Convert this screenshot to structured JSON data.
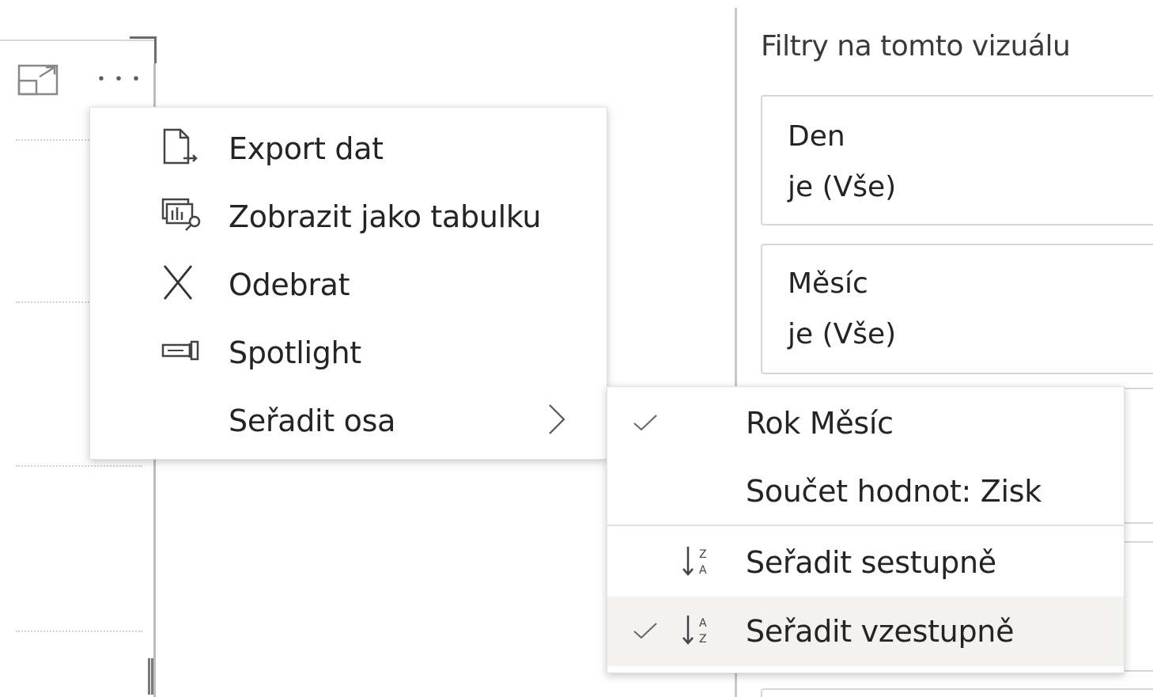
{
  "filter_pane": {
    "title": "Filtry na tomto vizuálu",
    "cards": [
      {
        "name": "Den",
        "value": "je (Vše)"
      },
      {
        "name": "Měsíc",
        "value": "je (Vše)"
      }
    ]
  },
  "visual_header": {
    "focus_icon": "focus-mode-icon",
    "more_icon": "more-options-icon"
  },
  "context_menu": {
    "items": [
      {
        "label": "Export dat",
        "icon": "export-data-icon"
      },
      {
        "label": "Zobrazit jako tabulku",
        "icon": "show-as-table-icon"
      },
      {
        "label": "Odebrat",
        "icon": "remove-icon"
      },
      {
        "label": "Spotlight",
        "icon": "spotlight-icon"
      },
      {
        "label": "Seřadit osa",
        "icon": "chevron-right-icon"
      }
    ]
  },
  "sort_submenu": {
    "fields": [
      {
        "label": "Rok Měsíc",
        "checked": true
      },
      {
        "label": "Součet hodnot: Zisk",
        "checked": false
      }
    ],
    "orders": [
      {
        "label": "Seřadit sestupně",
        "checked": false,
        "icon": "sort-descending-icon",
        "icon_glyph_top": "Z",
        "icon_glyph_bottom": "A"
      },
      {
        "label": "Seřadit vzestupně",
        "checked": true,
        "icon": "sort-ascending-icon",
        "icon_glyph_top": "A",
        "icon_glyph_bottom": "Z"
      }
    ]
  },
  "colors": {
    "menu_hover": "#f3f2f1",
    "text": "#252423",
    "border": "#e1e1e1"
  }
}
